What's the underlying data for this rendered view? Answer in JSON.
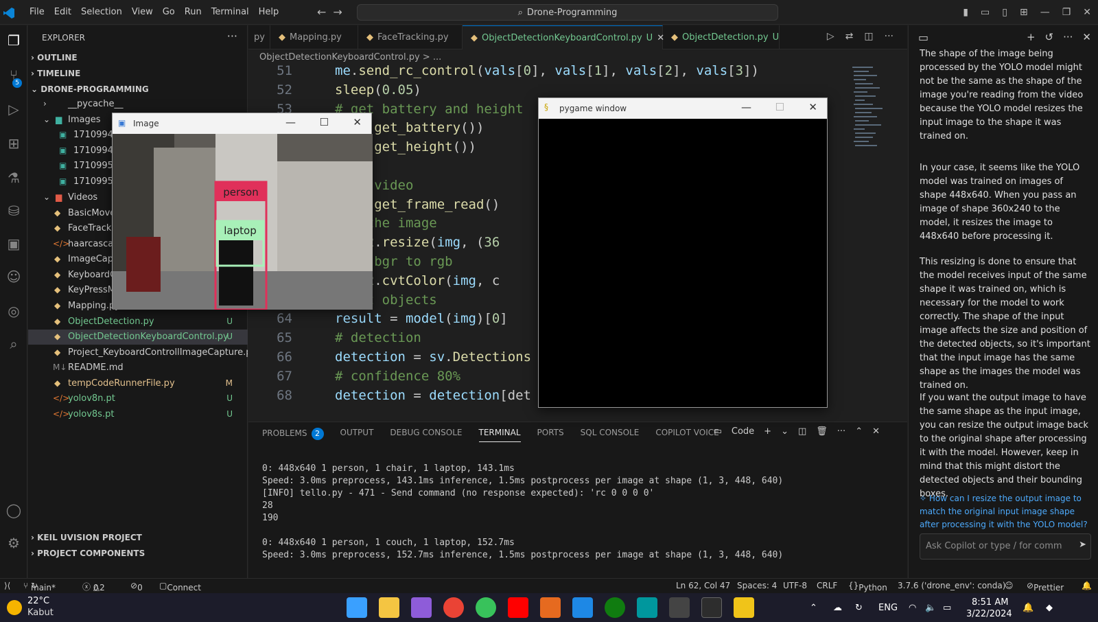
{
  "menu": [
    "File",
    "Edit",
    "Selection",
    "View",
    "Go",
    "Run",
    "Terminal",
    "Help"
  ],
  "search": {
    "label": "Drone-Programming"
  },
  "explorer": {
    "title": "EXPLORER",
    "outline": "OUTLINE",
    "timeline": "TIMELINE",
    "project": "DRONE-PROGRAMMING",
    "items": [
      {
        "label": "__pycache__",
        "git": ""
      },
      {
        "label": "Images",
        "git": ""
      },
      {
        "label": "17109946",
        "git": ""
      },
      {
        "label": "17109946",
        "git": ""
      },
      {
        "label": "17109953",
        "git": ""
      },
      {
        "label": "17109953",
        "git": ""
      },
      {
        "label": "Videos",
        "git": ""
      },
      {
        "label": "BasicMove",
        "git": ""
      },
      {
        "label": "FaceTrackin",
        "git": ""
      },
      {
        "label": "haarcascad",
        "git": ""
      },
      {
        "label": "ImageCapt",
        "git": ""
      },
      {
        "label": "KeyboardC",
        "git": ""
      },
      {
        "label": "KeyPressM",
        "git": ""
      },
      {
        "label": "Mapping.py",
        "git": ""
      },
      {
        "label": "ObjectDetection.py",
        "git": "U"
      },
      {
        "label": "ObjectDetectionKeyboardControl.py",
        "git": "U"
      },
      {
        "label": "Project_KeyboardControllImageCapture.py",
        "git": ""
      },
      {
        "label": "README.md",
        "git": ""
      },
      {
        "label": "tempCodeRunnerFile.py",
        "git": "M"
      },
      {
        "label": "yolov8n.pt",
        "git": "U"
      },
      {
        "label": "yolov8s.pt",
        "git": "U"
      }
    ],
    "keil": "KEIL UVISION PROJECT",
    "components": "PROJECT COMPONENTS"
  },
  "tabs": [
    {
      "label": "py",
      "mark": ""
    },
    {
      "label": "Mapping.py",
      "mark": ""
    },
    {
      "label": "FaceTracking.py",
      "mark": ""
    },
    {
      "label": "ObjectDetectionKeyboardControl.py",
      "mark": "U"
    },
    {
      "label": "ObjectDetection.py",
      "mark": "U"
    }
  ],
  "breadcrumb": "ObjectDetectionKeyboardControl.py > ...",
  "code": [
    {
      "ln": "51",
      "text": "me.send_rc_control(vals[0], vals[1], vals[2], vals[3])"
    },
    {
      "ln": "52",
      "text": "sleep(0.05)"
    },
    {
      "ln": "53",
      "text": "# get battery and height"
    },
    {
      "ln": "",
      "text": "t(me.get_battery())"
    },
    {
      "ln": "",
      "text": "t(me.get_height())"
    },
    {
      "ln": "",
      "text": ""
    },
    {
      "ln": "",
      "text": "ream video"
    },
    {
      "ln": "",
      "text": "= me.get_frame_read()"
    },
    {
      "ln": "",
      "text": "ize the image"
    },
    {
      "ln": "",
      "text": "= cv2.resize(img, (36"
    },
    {
      "ln": "",
      "text": "ange bgr to rgb"
    },
    {
      "ln": "",
      "text": "= cv2.cvtColor(img, c"
    },
    {
      "ln": "",
      "text": "etect objects"
    },
    {
      "ln": "64",
      "text": "result = model(img)[0]"
    },
    {
      "ln": "65",
      "text": "# detection"
    },
    {
      "ln": "66",
      "text": "detection = sv.Detections"
    },
    {
      "ln": "67",
      "text": "# confidence 80%"
    },
    {
      "ln": "68",
      "text": "detection = detection[det"
    }
  ],
  "panel": {
    "tabs": [
      "PROBLEMS",
      "OUTPUT",
      "DEBUG CONSOLE",
      "TERMINAL",
      "PORTS",
      "SQL CONSOLE",
      "COPILOT VOICE"
    ],
    "problems_count": "2",
    "terminal_label": "Code",
    "lines": [
      "0: 448x640 1 person, 1 chair, 1 laptop, 143.1ms",
      "Speed: 3.0ms preprocess, 143.1ms inference, 1.5ms postprocess per image at shape (1, 3, 448, 640)",
      "[INFO] tello.py - 471 - Send command (no response expected): 'rc 0 0 0 0'",
      "28",
      "190",
      "",
      "0: 448x640 1 person, 1 couch, 1 laptop, 152.7ms",
      "Speed: 3.0ms preprocess, 152.7ms inference, 1.5ms postprocess per image at shape (1, 3, 448, 640)"
    ]
  },
  "image_window": {
    "title": "Image",
    "label_person": "person",
    "label_laptop": "laptop"
  },
  "pygame_window": {
    "title": "pygame window"
  },
  "copilot": {
    "paras": [
      "The shape of the image being processed by the YOLO model might not be the same as the shape of the image you're reading from the video because the YOLO model resizes the input image to the shape it was trained on.",
      "In your case, it seems like the YOLO model was trained on images of shape 448x640. When you pass an image of shape 360x240 to the model, it resizes the image to 448x640 before processing it.",
      "This resizing is done to ensure that the model receives input of the same shape it was trained on, which is necessary for the model to work correctly. The shape of the input image affects the size and position of the detected objects, so it's important that the input image has the same shape as the images the model was trained on.",
      "If you want the output image to have the same shape as the input image, you can resize the output image back to the original shape after processing it with the model. However, keep in mind that this might distort the detected objects and their bounding boxes."
    ],
    "suggestion": "How can I resize the output image to match the original input image shape after processing it with the YOLO model?",
    "input_placeholder": "Ask Copilot or type / for comm"
  },
  "status": {
    "branch": "main*",
    "errors": "0",
    "warnings": "2",
    "ports": "0",
    "connect": "Connect",
    "position": "Ln 62, Col 47",
    "spaces": "Spaces: 4",
    "encoding": "UTF-8",
    "eol": "CRLF",
    "language": "Python",
    "interpreter": "3.7.6 ('drone_env': conda)",
    "prettier": "Prettier"
  },
  "taskbar": {
    "temp": "22°C",
    "weather": "Kabut",
    "lang": "ENG",
    "time": "8:51 AM",
    "date": "3/22/2024"
  }
}
